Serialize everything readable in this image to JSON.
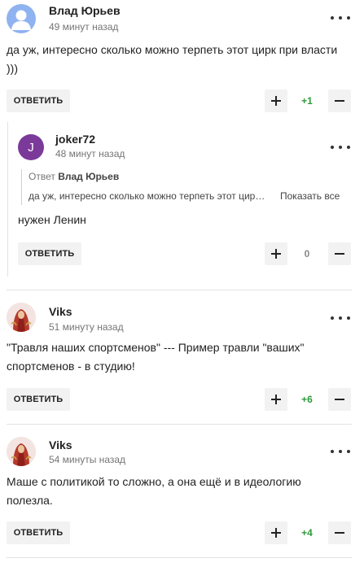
{
  "comments": [
    {
      "author": "Влад Юрьев",
      "time": "49 минут назад",
      "avatar_icon": "user-silhouette-icon",
      "text_line1": "да уж, интересно сколько можно терпеть этот цирк при власти",
      "text_line2": ")))",
      "reply_label": "ОТВЕТИТЬ",
      "score": "+1"
    },
    {
      "author": "joker72",
      "time": "48 минут назад",
      "avatar_letter": "J",
      "quote_prefix": "Ответ",
      "quote_author": "Влад Юрьев",
      "quote_text": "да уж, интересно сколько можно терпеть этот цирк при власти )))",
      "show_all_label": "Показать все",
      "text_line1": "нужен Ленин",
      "reply_label": "ОТВЕТИТЬ",
      "score": "0"
    },
    {
      "author": "Viks",
      "time": "51 минуту назад",
      "text_line1": "\"Травля наших спортсменов\" --- Пример травли \"ваших\"",
      "text_line2": "спортсменов - в студию!",
      "reply_label": "ОТВЕТИТЬ",
      "score": "+6"
    },
    {
      "author": "Viks",
      "time": "54 минуты назад",
      "text_line1": "Маше с политикой то сложно, а она ещё и в идеологию",
      "text_line2": "полезла.",
      "reply_label": "ОТВЕТИТЬ",
      "score": "+4"
    }
  ],
  "colors": {
    "score_positive": "#2e9b3e",
    "score_zero": "#888888",
    "button_bg": "#f2f2f2",
    "avatar_letter_bg": "#7b3a9a",
    "avatar_default_bg": "#8fb3f0"
  }
}
